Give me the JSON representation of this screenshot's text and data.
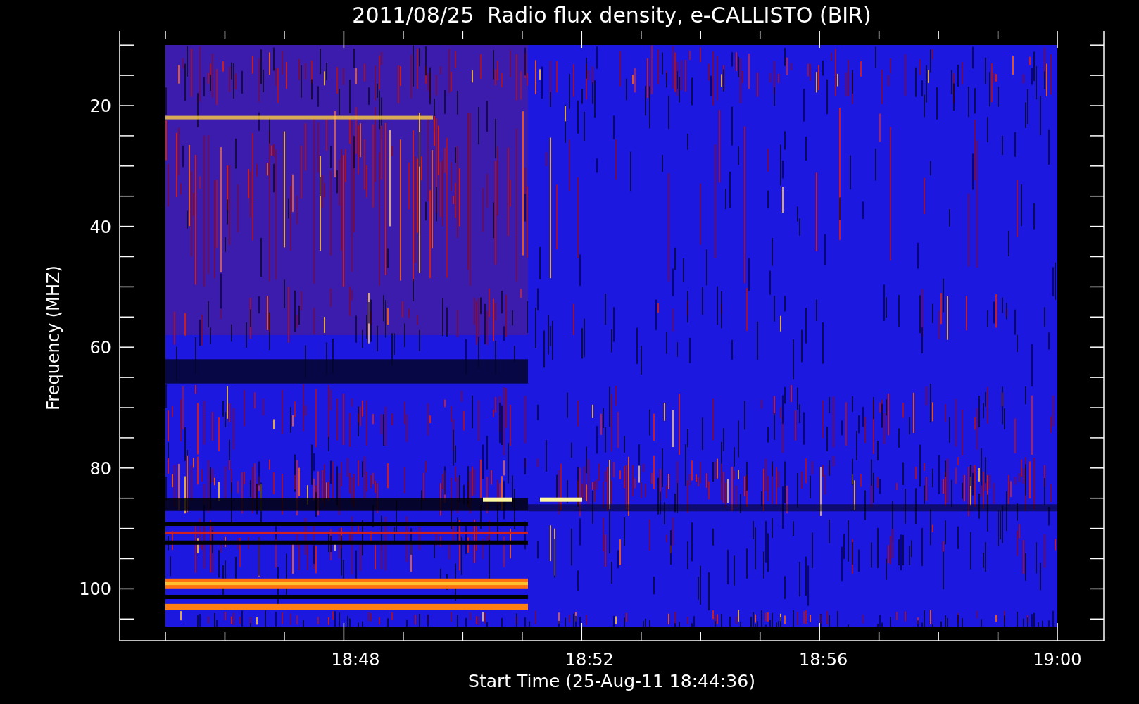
{
  "title": "2011/08/25  Radio flux density, e-CALLISTO (BIR)",
  "y_axis": {
    "label": "Frequency (MHZ)",
    "ticks": [
      "20",
      "40",
      "60",
      "80",
      "100"
    ]
  },
  "x_axis": {
    "label": "Start Time (25-Aug-11 18:44:36)",
    "ticks": [
      "18:48",
      "18:52",
      "18:56",
      "19:00"
    ]
  }
}
